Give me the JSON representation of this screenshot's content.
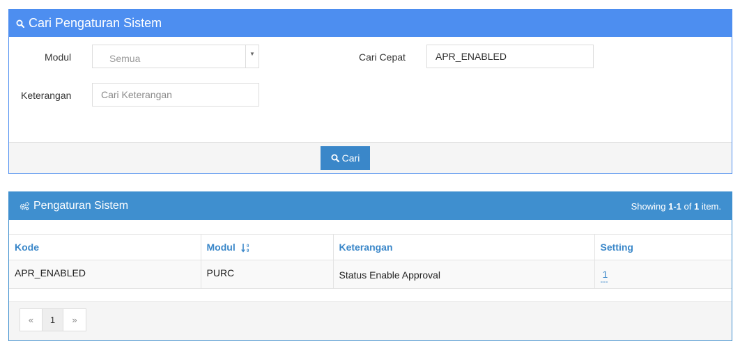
{
  "search_panel": {
    "title": "Cari Pengaturan Sistem",
    "modul_label": "Modul",
    "modul_value": "Semua",
    "cari_cepat_label": "Cari Cepat",
    "cari_cepat_value": "APR_ENABLED",
    "keterangan_label": "Keterangan",
    "keterangan_placeholder": "Cari Keterangan",
    "search_button": "Cari"
  },
  "result_panel": {
    "title": "Pengaturan Sistem",
    "summary_prefix": "Showing ",
    "summary_range": "1-1",
    "summary_of": " of ",
    "summary_total": "1",
    "summary_suffix": " item.",
    "columns": [
      "Kode",
      "Modul",
      "Keterangan",
      "Setting"
    ],
    "rows": [
      {
        "kode": "APR_ENABLED",
        "modul": "PURC",
        "keterangan": "Status Enable Approval",
        "setting": "1",
        "setting_sub": "---"
      }
    ],
    "pagination": {
      "prev": "«",
      "page": "1",
      "next": "»"
    }
  },
  "colors": {
    "search_header": "#4d8ef0",
    "result_header": "#3f8fcf",
    "button": "#3a87c9",
    "link": "#3a87c9"
  },
  "icons": [
    "search-icon",
    "gears-icon",
    "sort-numeric-icon"
  ]
}
